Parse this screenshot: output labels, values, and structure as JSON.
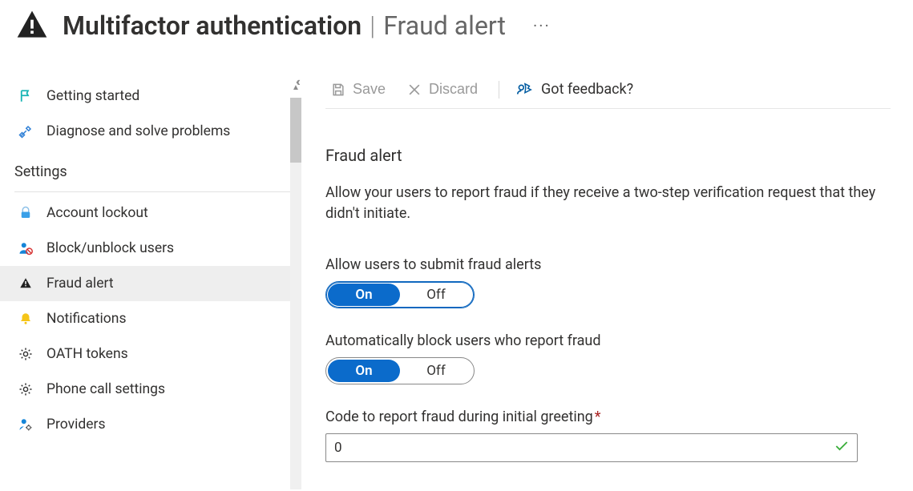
{
  "header": {
    "title_main": "Multifactor authentication",
    "title_sub": "Fraud alert"
  },
  "sidebar": {
    "items_top": [
      {
        "label": "Getting started",
        "icon": "flag"
      },
      {
        "label": "Diagnose and solve problems",
        "icon": "tools"
      }
    ],
    "section_label": "Settings",
    "items": [
      {
        "label": "Account lockout",
        "icon": "lock"
      },
      {
        "label": "Block/unblock users",
        "icon": "user-block"
      },
      {
        "label": "Fraud alert",
        "icon": "alert",
        "selected": true
      },
      {
        "label": "Notifications",
        "icon": "bell"
      },
      {
        "label": "OATH tokens",
        "icon": "gear"
      },
      {
        "label": "Phone call settings",
        "icon": "gear"
      },
      {
        "label": "Providers",
        "icon": "user-gear"
      }
    ]
  },
  "toolbar": {
    "save_label": "Save",
    "discard_label": "Discard",
    "feedback_label": "Got feedback?"
  },
  "main": {
    "heading": "Fraud alert",
    "description": "Allow your users to report fraud if they receive a two-step verification request that they didn't initiate.",
    "setting_allow_label": "Allow users to submit fraud alerts",
    "setting_block_label": "Automatically block users who report fraud",
    "setting_code_label": "Code to report fraud during initial greeting",
    "toggle_on": "On",
    "toggle_off": "Off",
    "code_value": "0"
  }
}
